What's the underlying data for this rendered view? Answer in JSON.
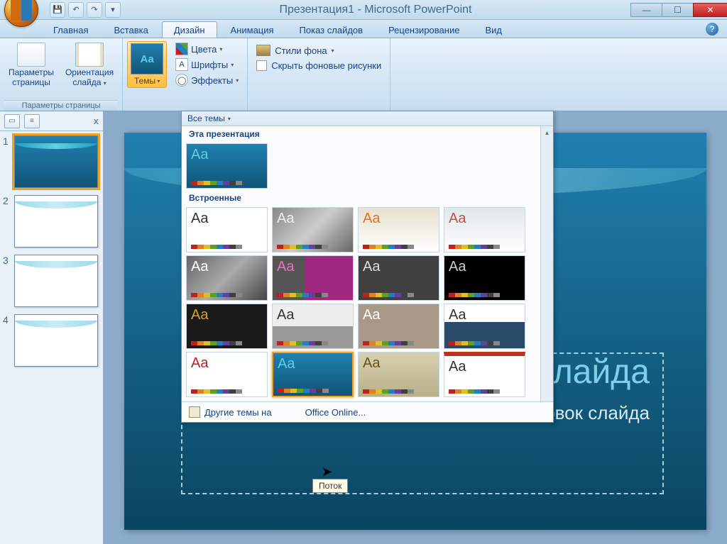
{
  "window": {
    "title": "Презентация1 - Microsoft PowerPoint"
  },
  "tabs": {
    "home": "Главная",
    "insert": "Вставка",
    "design": "Дизайн",
    "animation": "Анимация",
    "slideshow": "Показ слайдов",
    "review": "Рецензирование",
    "view": "Вид"
  },
  "ribbon": {
    "page_setup_label": "Параметры страницы",
    "page_setup_btn": "Параметры\nстраницы",
    "orientation_btn": "Ориентация\nслайда",
    "themes_btn": "Темы",
    "colors": "Цвета",
    "fonts": "Шрифты",
    "effects": "Эффекты",
    "bg_styles": "Стили фона",
    "hide_bg": "Скрыть фоновые рисунки"
  },
  "themes_panel": {
    "all_themes": "Все темы",
    "this_presentation": "Эта презентация",
    "builtin": "Встроенные",
    "footer": "Другие темы на",
    "footer2": "Office Online..."
  },
  "tooltip": "Поток",
  "thumbs": {
    "n1": "1",
    "n2": "2",
    "n3": "3",
    "n4": "4"
  },
  "slide": {
    "title_fragment": "слайда",
    "subtitle_fragment": "ловок слайда"
  },
  "icons": {
    "aa": "Aa",
    "a": "A",
    "help": "?",
    "dropdown": "▾",
    "up": "▴",
    "save": "💾",
    "undo": "↶",
    "redo": "↷",
    "close_x": "x"
  }
}
